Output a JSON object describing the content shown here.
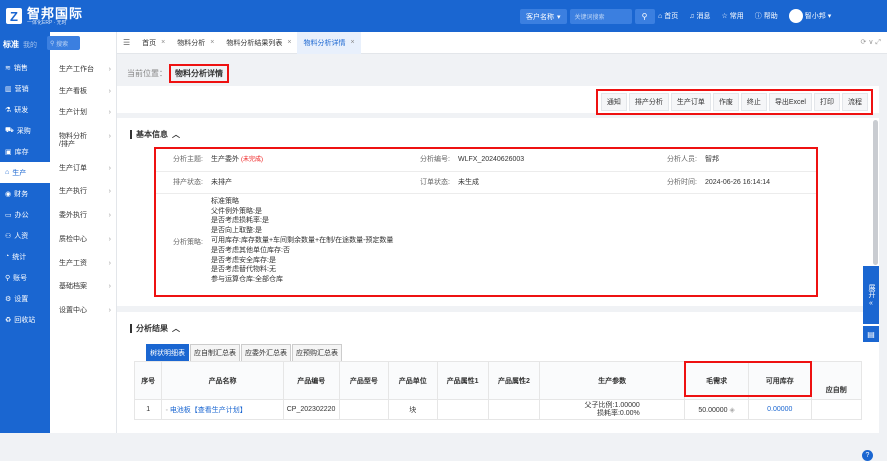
{
  "brand": {
    "name": "智邦国际",
    "subtitle": "一体化ERP · 无时"
  },
  "topbar": {
    "customer_select": "客户名称",
    "keyword_placeholder": "关键词搜索",
    "nav": [
      "首页",
      "消息",
      "常用",
      "帮助",
      "智小邦"
    ]
  },
  "sidebar": {
    "tabs": [
      "标准",
      "我的"
    ],
    "search_label": "搜索",
    "items": [
      {
        "icon": "chart-line-icon",
        "label": "销售"
      },
      {
        "icon": "chart-bar-icon",
        "label": "营销"
      },
      {
        "icon": "flask-icon",
        "label": "研发"
      },
      {
        "icon": "cart-icon",
        "label": "采购"
      },
      {
        "icon": "box-icon",
        "label": "库存"
      },
      {
        "icon": "factory-icon",
        "label": "生产"
      },
      {
        "icon": "money-icon",
        "label": "财务"
      },
      {
        "icon": "briefcase-icon",
        "label": "办公"
      },
      {
        "icon": "people-icon",
        "label": "人资"
      },
      {
        "icon": "pie-icon",
        "label": "统计"
      },
      {
        "icon": "account-icon",
        "label": "账号"
      },
      {
        "icon": "settings-icon",
        "label": "设置"
      },
      {
        "icon": "recycle-icon",
        "label": "回收站"
      }
    ],
    "active_index": 5
  },
  "submenu": {
    "items": [
      "生产工作台",
      "生产看板",
      "生产计划",
      "物料分析\n/排产",
      "生产订单",
      "生产执行",
      "委外执行",
      "质检中心",
      "生产工资",
      "基础档案",
      "设置中心"
    ]
  },
  "tabs": {
    "items": [
      {
        "label": "首页",
        "active": false
      },
      {
        "label": "物料分析",
        "active": false
      },
      {
        "label": "物料分析结果列表",
        "active": false
      },
      {
        "label": "物料分析详情",
        "active": true
      }
    ]
  },
  "breadcrumb": {
    "prefix": "当前位置：",
    "current": "物料分析详情"
  },
  "toolbar": {
    "buttons": [
      "通知",
      "排产分析",
      "生产订单",
      "作废",
      "终止",
      "导出Excel",
      "打印",
      "流程"
    ]
  },
  "basic_info": {
    "title": "基本信息",
    "subject_label": "分析主题:",
    "subject_value": "生产委外",
    "subject_status": "(未完成)",
    "code_label": "分析编号:",
    "code_value": "WLFX_20240626003",
    "person_label": "分析人员:",
    "person_value": "智邦",
    "schedule_label": "排产状态:",
    "schedule_value": "未排产",
    "order_label": "订单状态:",
    "order_value": "未生成",
    "time_label": "分析时间:",
    "time_value": "2024-06-26 16:14:14",
    "strategy_label": "分析策略:",
    "strategy_value": "标准策略\n父件例外策略:是\n是否考虑损耗率:是\n是否向上取整:是\n可用库存:库存数量+车间剩余数量+在制/在途数量-预定数量\n是否考虑其他单位库存:否\n是否考虑安全库存:是\n是否考虑替代物料:无\n参与运算仓库:全部仓库"
  },
  "results": {
    "title": "分析结果",
    "subtabs": [
      "树状明细表",
      "应自制汇总表",
      "应委外汇总表",
      "应预购汇总表"
    ],
    "columns": [
      "序号",
      "产品名称",
      "产品编号",
      "产品型号",
      "产品单位",
      "产品属性1",
      "产品属性2",
      "生产参数",
      "毛需求",
      "可用库存",
      "应自制"
    ],
    "rows": [
      {
        "no": "1",
        "name": "电池板【查看生产计划】",
        "code": "CP_202302220",
        "model": "",
        "unit": "块",
        "attr1": "",
        "attr2": "",
        "params": "父子比例:1.00000\n损耗率:0.00%",
        "gross": "50.00000",
        "stock": "0.00000",
        "self_make": ""
      }
    ]
  },
  "side_float": {
    "expand_label": "展开"
  }
}
